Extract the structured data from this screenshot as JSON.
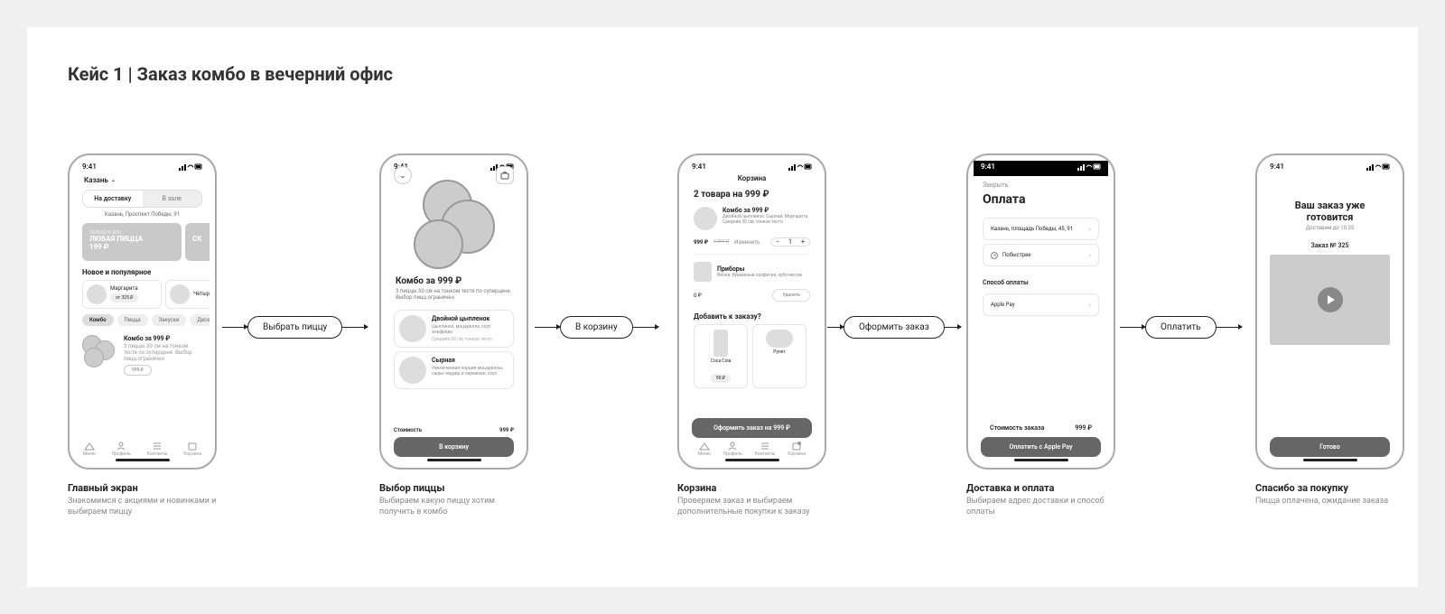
{
  "title": "Кейс 1 | Заказ  комбо в вечерний офис",
  "status": {
    "time": "9:41"
  },
  "flow": {
    "a1": "Выбрать пиццу",
    "a2": "В корзину",
    "a3": "Оформить заказ",
    "a4": "Оплатить"
  },
  "captions": {
    "s1": {
      "h": "Главный экран",
      "p": "Знакомимся с акциями и новинками и выбираем пиццу"
    },
    "s2": {
      "h": "Выбор пиццы",
      "p": "Выбираем какую пиццу хотим получить в комбо"
    },
    "s3": {
      "h": "Корзина",
      "p": "Проверяем заказ и выбираем дополнительные покупки к заказу"
    },
    "s4": {
      "h": "Доставка и оплата",
      "p": "Выбираем адрес доставки и способ оплаты"
    },
    "s5": {
      "h": "Спасибо за покупку",
      "p": "Пицца оплачена, ожидание заказа"
    }
  },
  "s1": {
    "city": "Казань",
    "tab_delivery": "На доставку",
    "tab_hall": "В зале",
    "address": "Казань, Проспект Победы, 91",
    "promo_tag": "ТОЛЬКО В АПП",
    "promo_line1": "ЛЮБАЯ ПИЦЦА",
    "promo_line2": "199 ₽",
    "promo2": "СК",
    "sec_new": "Новое и популярное",
    "card1": "Маргарита",
    "card1_price": "от 325 ₽",
    "card2": "Четыр",
    "chip_combo": "Комбо",
    "chip_pizza": "Пицца",
    "chip_snack": "Закуски",
    "chip_dessert": "Десерты",
    "combo_name": "Комбо за 999 ₽",
    "combo_desc": "3 пиццы 30 см на тонком тесте по суперцене. Выбор пицц ограничен",
    "combo_price": "999 ₽",
    "nav_menu": "Меню",
    "nav_profile": "Профиль",
    "nav_contacts": "Контакты",
    "nav_cart": "Корзина"
  },
  "s2": {
    "title": "Комбо за 999 ₽",
    "desc": "3 пиццы 30 см на тонком тесте по суперцене. Выбор пицц ограничен",
    "opt1": "Двойной цыпленок",
    "opt1_desc": "Цыпленок, моцарелла, соус альфредо",
    "opt1_sub": "Средняя 30 см, тонкое тесто",
    "opt2": "Сырная",
    "opt2_desc": "Увеличенная порция моцареллы, сыры чеддер и пармезан, соус",
    "cost_label": "Стоимость",
    "cost_value": "999 ₽",
    "btn": "В корзину"
  },
  "s3": {
    "title": "Корзина",
    "summary": "2 товара на 999  ₽",
    "item1": "Комбо за 999 ₽",
    "item1_desc": "Двойной цыпленок, Сырная, Маргарита",
    "item1_sub": "Средняя 30 см, тонкое тесто",
    "price": "999 ₽",
    "old_price": "1 397 ₽",
    "change": "Изменить",
    "qty": "1",
    "utensils": "Приборы",
    "utensils_desc": "Вилки, бумажные салфетки, зубочистки",
    "utensils_price": "0 ₽",
    "delete": "Удалить",
    "add_title": "Добавить к заказу?",
    "add1": "Coca Cola",
    "add1_price": "90 ₽",
    "add2": "Рулет",
    "btn": "Оформить заказ на 999 ₽"
  },
  "s4": {
    "close": "Закрыть",
    "title": "Оплата",
    "address": "Казань, площадь Победы, 45, 91",
    "speed": "Побыстрее",
    "pay_section": "Способ оплаты",
    "pay_method": "Apple Pay",
    "cost_label": "Стоимость заказа",
    "cost_value": "999 ₽",
    "btn": "Оплатить с Apple Pay"
  },
  "s5": {
    "title": "Ваш заказ уже готовится",
    "sub": "Доставим до 10:35",
    "order": "Заказ № 325",
    "btn": "Готово"
  }
}
